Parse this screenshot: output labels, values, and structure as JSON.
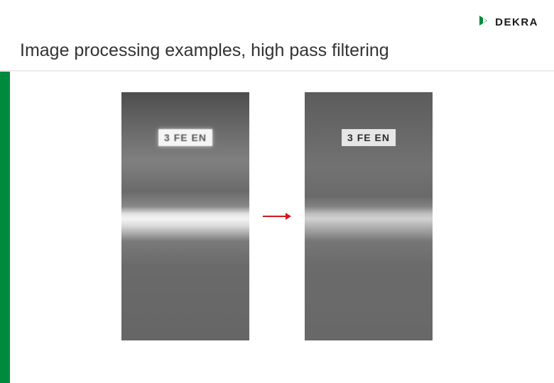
{
  "brand": {
    "name": "DEKRA",
    "logo_color": "#008a3e"
  },
  "slide": {
    "title": "Image processing examples, high pass filtering"
  },
  "figure": {
    "left_tag": "3 FE EN",
    "right_tag": "3 FE EN",
    "arrow_color": "#d4181f"
  }
}
